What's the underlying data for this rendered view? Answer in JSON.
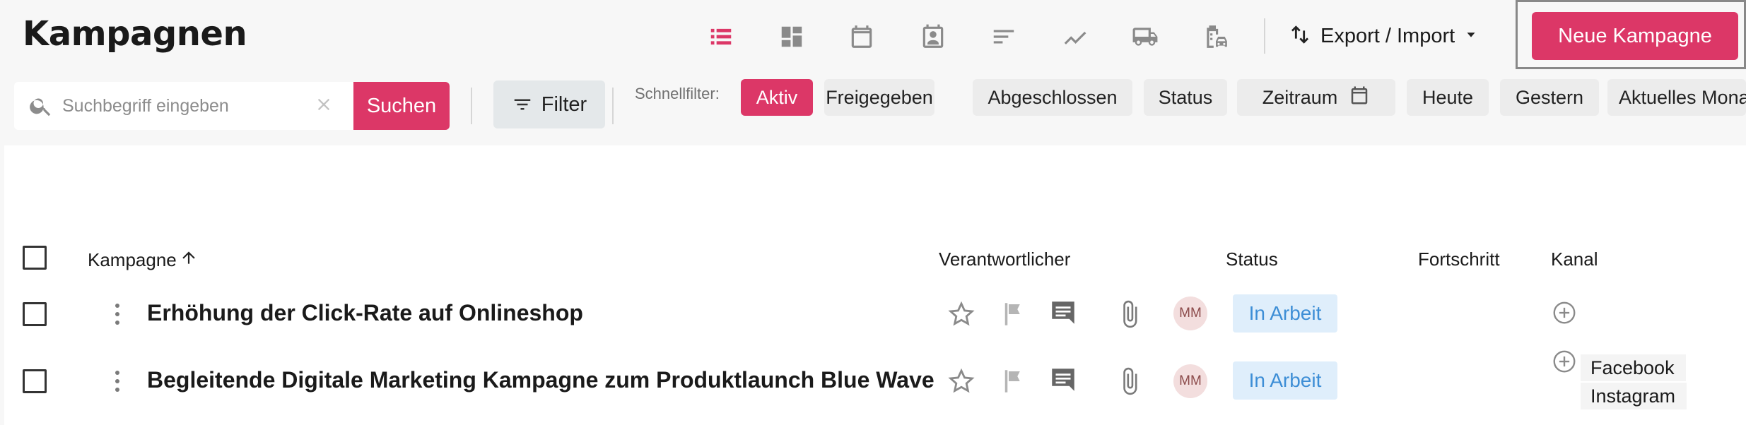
{
  "page": {
    "title": "Kampagnen"
  },
  "toolbar": {
    "view_icons": [
      "list-view-icon",
      "dashboard-view-icon",
      "calendar-icon",
      "calendar-badge-icon",
      "sort-lines-icon",
      "timeline-chart-icon",
      "truck-icon",
      "building-car-icon"
    ],
    "export_label": "Export / Import",
    "new_campaign_label": "Neue Kampagne"
  },
  "search": {
    "placeholder": "Suchbegriff eingeben",
    "value": "",
    "button_label": "Suchen"
  },
  "filter": {
    "button_label": "Filter",
    "quick_label": "Schnellfilter:",
    "chips": [
      "Aktiv",
      "Freigegeben",
      "Abgeschlossen",
      "Status",
      "Zeitraum",
      "Heute",
      "Gestern",
      "Aktuelles Monat"
    ],
    "active_chip": "Aktiv"
  },
  "table": {
    "columns": {
      "campaign": "Kampagne",
      "owner": "Verantwortlicher",
      "status": "Status",
      "progress": "Fortschritt",
      "channel": "Kanal"
    },
    "sort": {
      "column": "Kampagne",
      "direction": "ascending"
    },
    "rows": [
      {
        "title": "Erhöhung der Click-Rate auf Onlineshop",
        "owner_initials": "MM",
        "status": "In Arbeit",
        "channels": []
      },
      {
        "title": "Begleitende Digitale Marketing Kampagne zum Produktlaunch Blue Wave",
        "owner_initials": "MM",
        "status": "In Arbeit",
        "channels": [
          "Facebook",
          "Instagram"
        ]
      }
    ]
  },
  "colors": {
    "accent": "#dc3767",
    "status_text": "#3d8ed6",
    "status_bg": "#dfeefb",
    "avatar_bg": "#f3dede"
  }
}
